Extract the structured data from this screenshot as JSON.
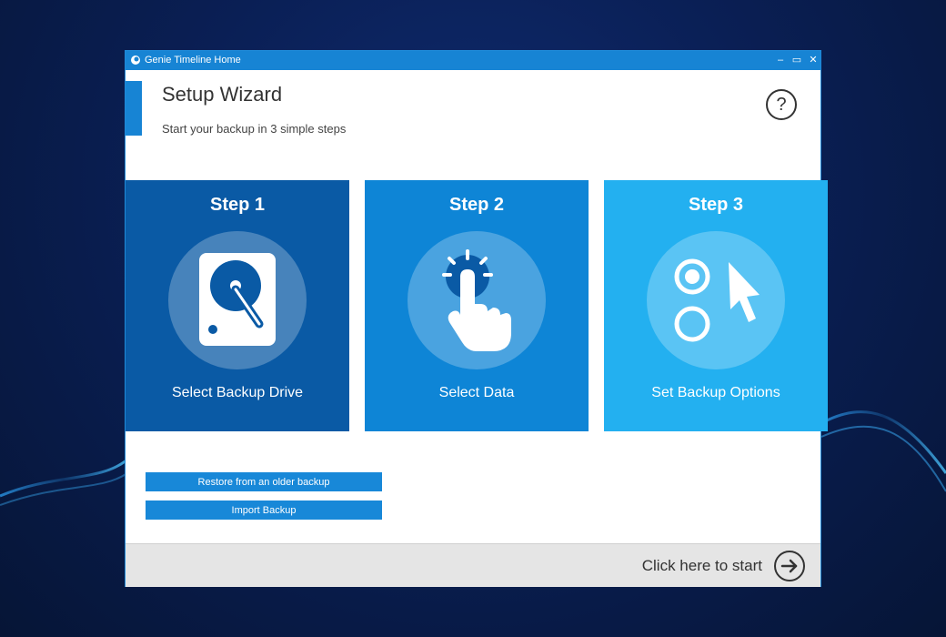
{
  "window": {
    "title": "Genie Timeline Home",
    "controls": {
      "minimize": "–",
      "maximize": "▭",
      "close": "✕"
    }
  },
  "header": {
    "title": "Setup Wizard",
    "subtitle": "Start your backup in 3 simple steps",
    "help": "?"
  },
  "steps": [
    {
      "label": "Step 1",
      "caption": "Select Backup Drive",
      "icon": "hard-drive-icon",
      "color": "#0a5aa5"
    },
    {
      "label": "Step 2",
      "caption": "Select Data",
      "icon": "hand-pointer-icon",
      "color": "#0e85d6"
    },
    {
      "label": "Step 3",
      "caption": "Set Backup Options",
      "icon": "options-cursor-icon",
      "color": "#23b0f0"
    }
  ],
  "actions": {
    "restore": "Restore from an older backup",
    "import": "Import Backup"
  },
  "footer": {
    "start": "Click here to start"
  },
  "colors": {
    "accent": "#1784d4",
    "footer_bg": "#e5e5e5"
  }
}
